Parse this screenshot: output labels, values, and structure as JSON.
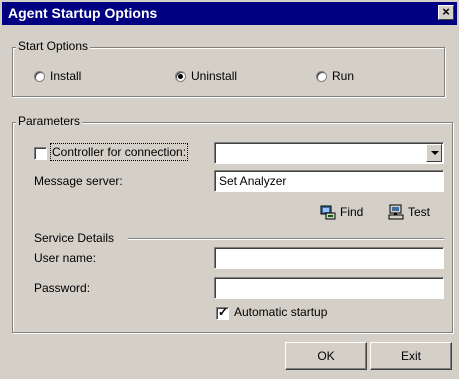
{
  "window": {
    "title": "Agent Startup Options",
    "close_symbol": "×"
  },
  "start_options": {
    "legend": "Start Options",
    "options": [
      {
        "label": "Install",
        "selected": false
      },
      {
        "label": "Uninstall",
        "selected": true
      },
      {
        "label": "Run",
        "selected": false
      }
    ]
  },
  "parameters": {
    "legend": "Parameters",
    "controller_label": "Controller for connection:",
    "controller_checked": false,
    "controller_value": "",
    "message_server_label": "Message server:",
    "message_server_value": "Set Analyzer",
    "find_label": "Find",
    "test_label": "Test",
    "service_details_label": "Service Details",
    "user_name_label": "User name:",
    "user_name_value": "",
    "password_label": "Password:",
    "password_value": "",
    "automatic_startup_label": "Automatic startup",
    "automatic_startup_checked": true
  },
  "buttons": {
    "ok": "OK",
    "exit": "Exit"
  },
  "icons": {
    "find": "find-icon",
    "test": "test-icon",
    "dropdown": "chevron-down-icon"
  },
  "colors": {
    "titlebar": "#000080",
    "face": "#d4d0c8"
  }
}
